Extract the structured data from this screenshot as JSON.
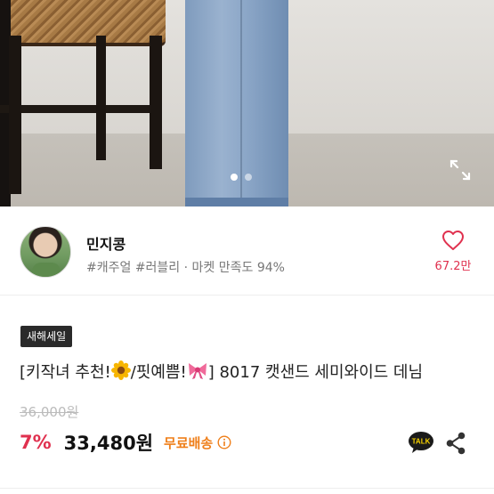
{
  "gallery": {
    "slide_count": 2,
    "active_slide": 1,
    "expand_icon": "fullscreen-expand-icon"
  },
  "seller": {
    "name": "민지콩",
    "tags": "#캐주얼 #러블리 · 마켓 만족도 94%",
    "like_count": "67.2만",
    "like_icon": "heart-outline-icon",
    "accent_color": "#e0314f"
  },
  "product": {
    "badge": "새해세일",
    "title_prefix": "[키작녀 추천!",
    "title_mid": "/핏예쁨!",
    "title_suffix": "] 8017 캣샌드 세미와이드 데님",
    "title_emojis": [
      "sunflower-emoji",
      "ribbon-emoji"
    ],
    "original_price": "36,000원",
    "discount": "7%",
    "price": "33,480원",
    "shipping": "무료배송",
    "shipping_color": "#ef7f1a"
  },
  "actions": {
    "talk_label": "TALK",
    "talk_icon": "kakaotalk-icon",
    "share_icon": "share-icon"
  }
}
